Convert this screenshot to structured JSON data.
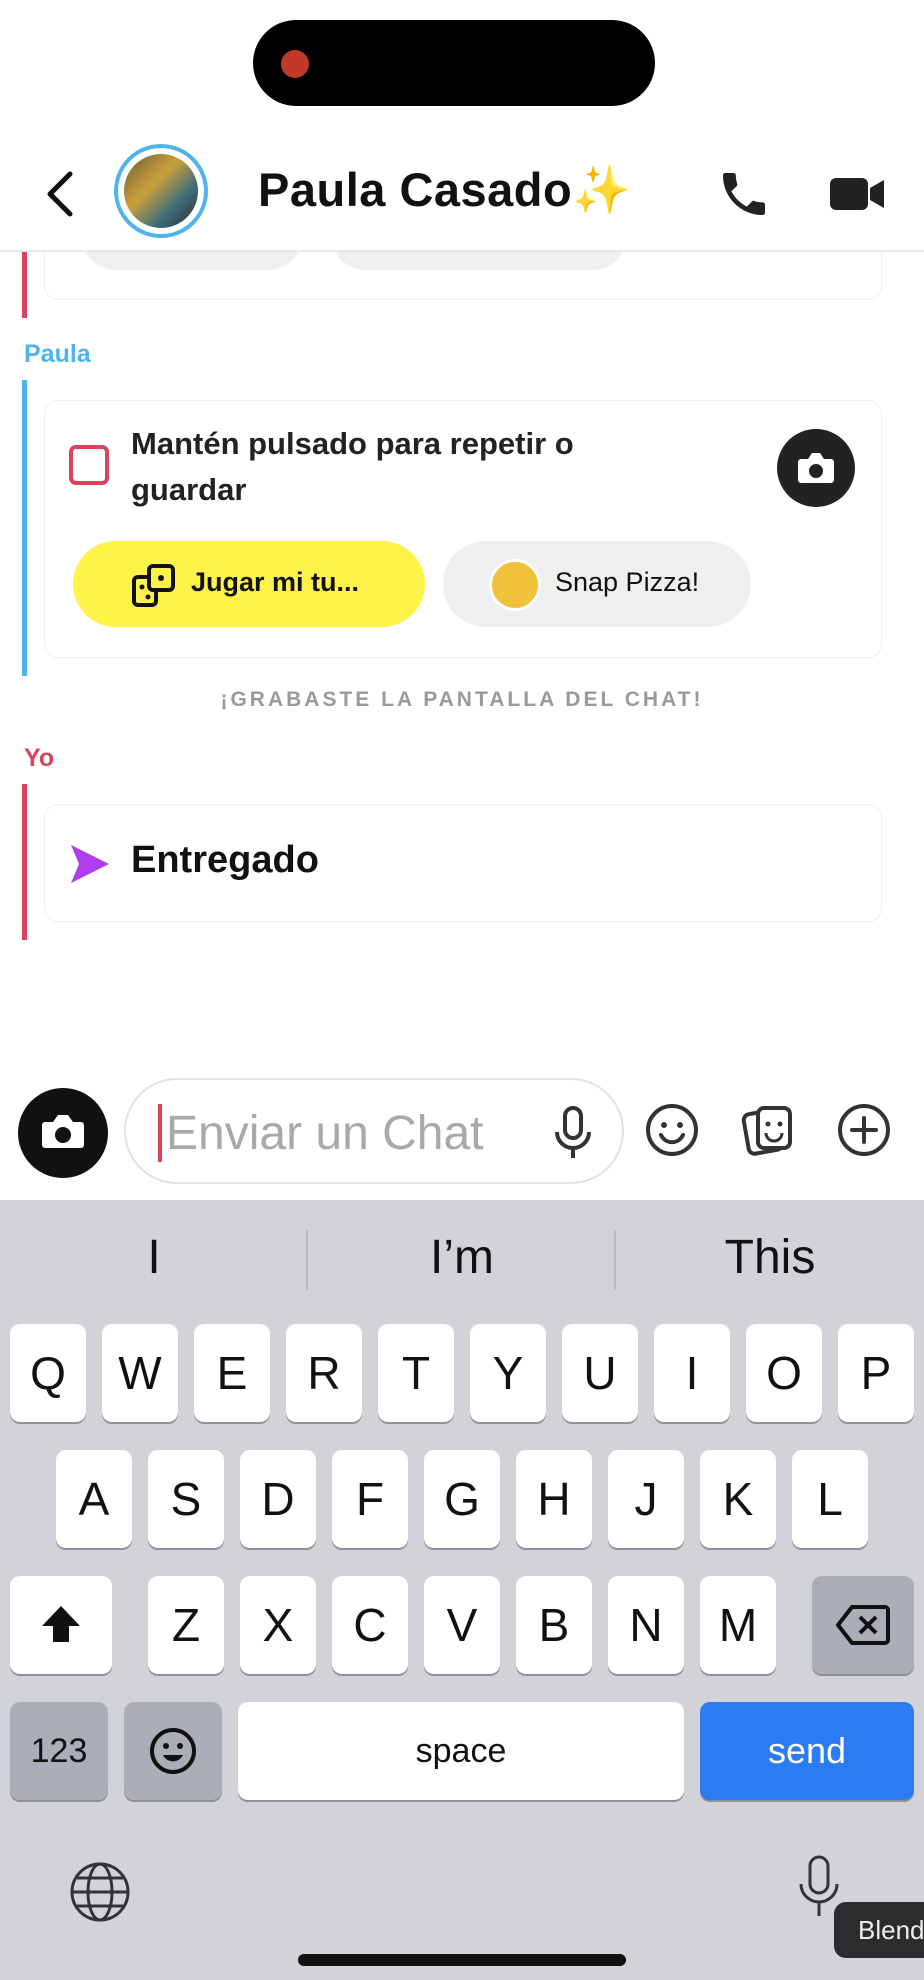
{
  "header": {
    "contact_name": "Paula Casado✨",
    "back_icon": "chevron-left-icon",
    "call_icon": "phone-icon",
    "video_icon": "video-camera-icon"
  },
  "messages": {
    "paula": {
      "sender": "Paula",
      "color": "#4fb4ee",
      "snap_text": "Mantén pulsado para repetir o guardar",
      "play_button": "Jugar mi tu...",
      "game_button": "Snap Pizza!"
    },
    "system_notice": "¡GRABASTE LA PANTALLA DEL CHAT!",
    "me": {
      "sender": "Yo",
      "color": "#d9435b",
      "status": "Entregado"
    }
  },
  "composer": {
    "placeholder": "Enviar un Chat"
  },
  "keyboard": {
    "suggestions": [
      "I",
      "I’m",
      "This"
    ],
    "row1": [
      "Q",
      "W",
      "E",
      "R",
      "T",
      "Y",
      "U",
      "I",
      "O",
      "P"
    ],
    "row2": [
      "A",
      "S",
      "D",
      "F",
      "G",
      "H",
      "J",
      "K",
      "L"
    ],
    "row3": [
      "Z",
      "X",
      "C",
      "V",
      "B",
      "N",
      "M"
    ],
    "numbers_key": "123",
    "space_key": "space",
    "send_key": "send"
  },
  "tooltip": "Blend",
  "colors": {
    "accent_yellow": "#fff34a",
    "send_blue": "#2b7cf0",
    "delivered_purple": "#b03cf0"
  }
}
